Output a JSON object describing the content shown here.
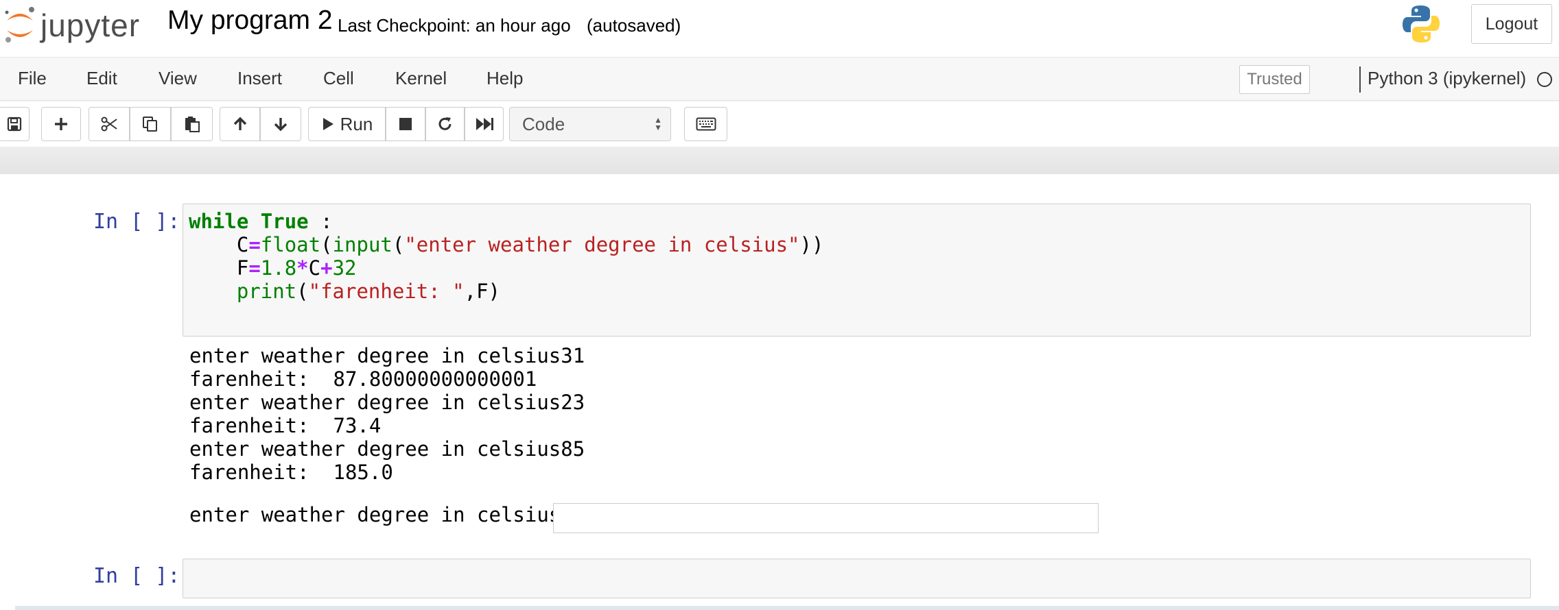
{
  "header": {
    "logo_text": "jupyter",
    "notebook_title": "My program 2",
    "checkpoint": "Last Checkpoint: an hour ago",
    "autosave": "(autosaved)",
    "logout_label": "Logout"
  },
  "menubar": {
    "items": [
      "File",
      "Edit",
      "View",
      "Insert",
      "Cell",
      "Kernel",
      "Help"
    ],
    "trusted_label": "Trusted",
    "kernel_name": "Python 3 (ipykernel)"
  },
  "toolbar": {
    "run_label": "Run",
    "cell_type": "Code"
  },
  "cells": [
    {
      "prompt": "In [ ]:",
      "code_lines": [
        "while True :",
        "    C=float(input(\"enter weather degree in celsius\"))",
        "    F=1.8*C+32",
        "    print(\"farenheit: \",F)"
      ],
      "output_lines": [
        "enter weather degree in celsius31",
        "farenheit:  87.80000000000001",
        "enter weather degree in celsius23",
        "farenheit:  73.4",
        "enter weather degree in celsius85",
        "farenheit:  185.0"
      ],
      "stdin_prompt": "enter weather degree in celsius",
      "stdin_value": ""
    },
    {
      "prompt": "In [ ]:",
      "code_lines": []
    }
  ],
  "colors": {
    "prompt": "#303f9f",
    "keyword": "#008000",
    "operator": "#aa22ff",
    "string": "#ba2121",
    "jupyter_orange": "#f37726"
  }
}
